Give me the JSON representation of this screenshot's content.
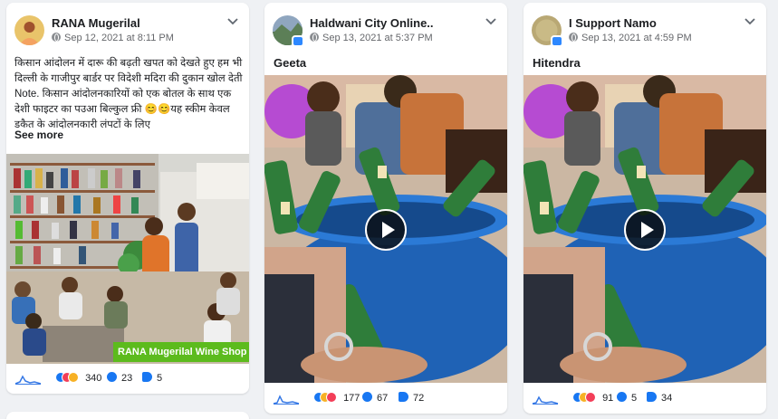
{
  "posts": [
    {
      "author": "RANA Mugerilal",
      "date": "Sep 12, 2021 at 8:11 PM",
      "text": "किसान आंदोलन में दारू की बढ़ती खपत को देखते हुए हम भी दिल्ली के गाजीपुर बार्डर पर विदेशी मदिरा की दुकान खोल देती Note. किसान आंदोलनकारियों को एक बोतल के साथ एक देशी फाइटर का पउआ बिल्कुल फ्री 😊😊यह स्कीम केवल डकैत के आंदोलनकारी लंपटों के लिए",
      "see_more": "See more",
      "banner": "RANA Mugerilal Wine Shop",
      "reactions": "340",
      "comments": "23",
      "shares": "5"
    },
    {
      "author": "Haldwani City Online..",
      "date": "Sep 13, 2021 at 5:37 PM",
      "title": "Geeta",
      "reactions": "177",
      "comments": "67",
      "shares": "72"
    },
    {
      "author": "I Support Namo",
      "date": "Sep 13, 2021 at 4:59 PM",
      "title": "Hitendra",
      "reactions": "91",
      "comments": "5",
      "shares": "34"
    }
  ],
  "icons": {
    "privacy": "globe-icon",
    "menu": "chevron-down-icon",
    "play": "play-icon",
    "trend": "sparkline-icon",
    "comments": "comment-icon",
    "shares": "share-icon"
  },
  "colors": {
    "page_bg": "#eff1f4",
    "card_bg": "#ffffff",
    "meta_text": "#65676b",
    "brand_blue": "#1877f2",
    "banner_green": "#5cbb1d"
  }
}
